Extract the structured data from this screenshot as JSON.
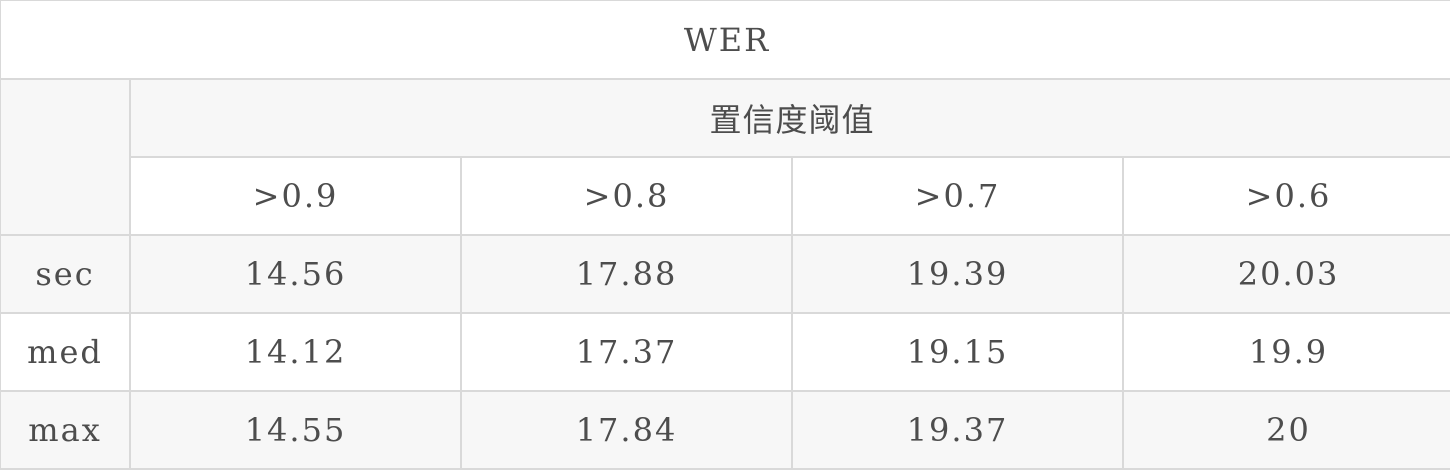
{
  "table": {
    "title": "WER",
    "group_header": "置信度阈值",
    "corner": "",
    "thresholds": [
      ">0.9",
      ">0.8",
      ">0.7",
      ">0.6"
    ],
    "rows": [
      {
        "label": "sec",
        "values": [
          "14.56",
          "17.88",
          "19.39",
          "20.03"
        ]
      },
      {
        "label": "med",
        "values": [
          "14.12",
          "17.37",
          "19.15",
          "19.9"
        ]
      },
      {
        "label": "max",
        "values": [
          "14.55",
          "17.84",
          "19.37",
          "20"
        ]
      }
    ]
  },
  "colors": {
    "border": "#d9d9d9",
    "striped_bg": "#f7f7f7",
    "text": "#4d4d4d"
  }
}
